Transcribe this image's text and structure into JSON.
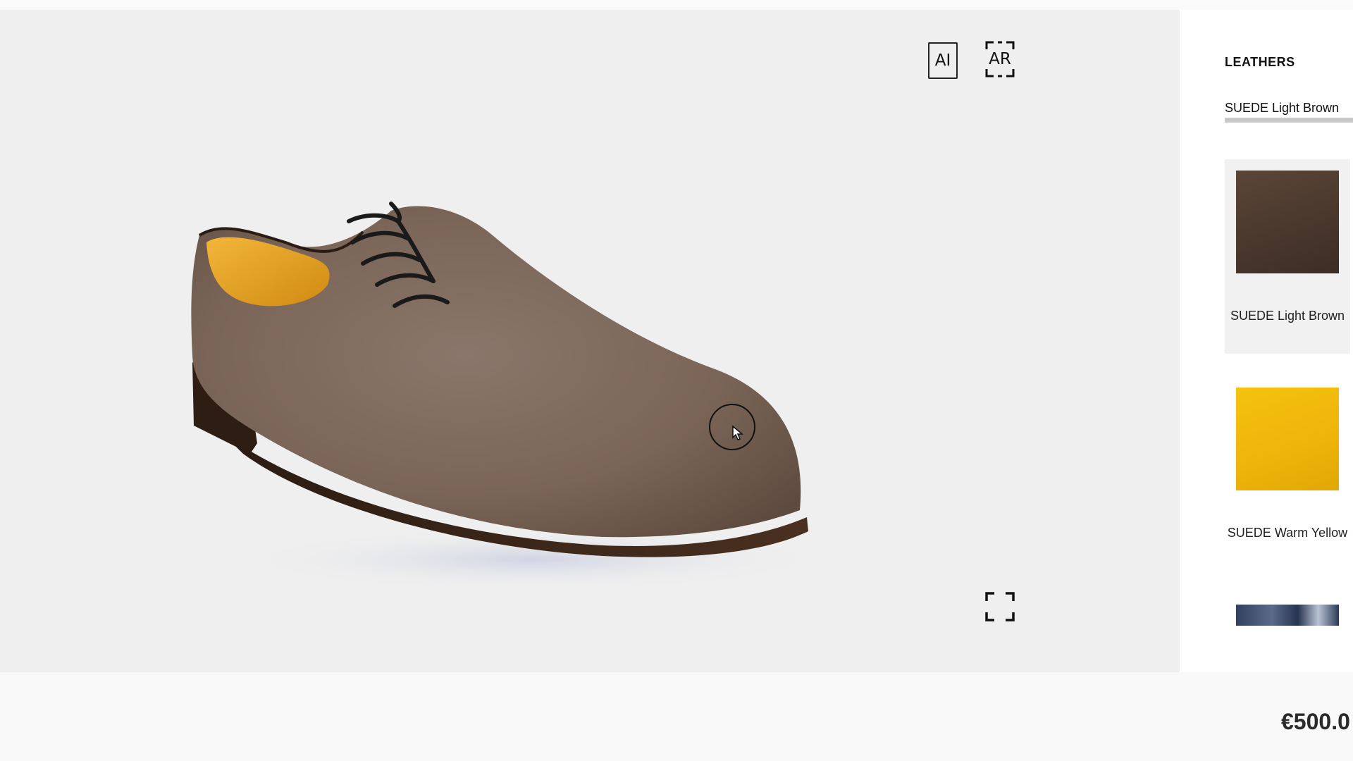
{
  "viewer": {
    "ai_label": "AI",
    "ar_label": "AR",
    "fullscreen_icon": "fullscreen-icon",
    "product": "shoe-3d-model"
  },
  "panel": {
    "heading": "LEATHERS",
    "active_tab": "SUEDE Light Brown",
    "swatches": [
      {
        "label": "SUEDE Light Brown",
        "color": "#4b3a30",
        "selected": true
      },
      {
        "label": "SUEDE Warm Yellow",
        "color": "#f0b90a",
        "selected": false
      },
      {
        "label": "",
        "color": "#2c3a55",
        "selected": false
      }
    ]
  },
  "footer": {
    "price": "€500.0"
  },
  "colors": {
    "viewer_bg": "#efefef",
    "panel_bg": "#ffffff",
    "suede": "#7e6a5c",
    "sole": "#3a2618",
    "lining": "#e8a318"
  }
}
